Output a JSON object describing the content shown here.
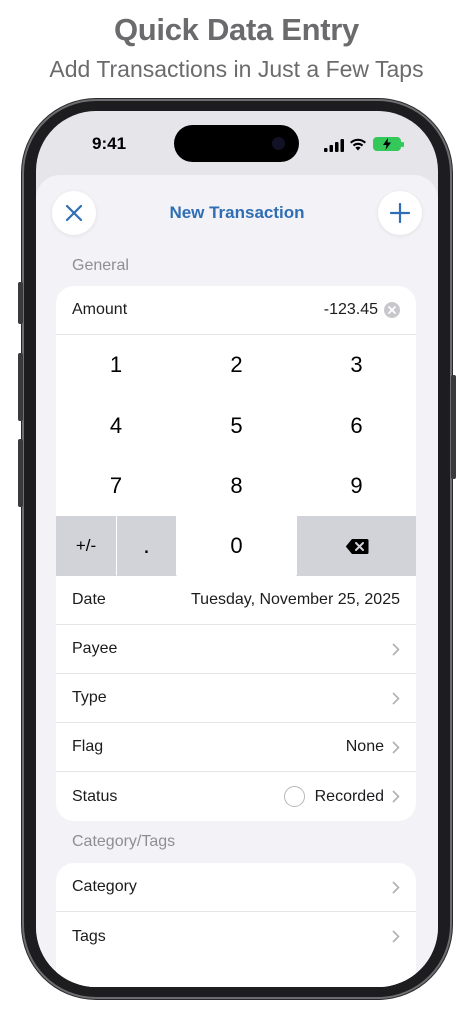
{
  "promo": {
    "title": "Quick Data Entry",
    "subtitle": "Add Transactions in Just a Few Taps"
  },
  "status_bar": {
    "time": "9:41"
  },
  "nav": {
    "title": "New Transaction",
    "close_icon": "close-icon",
    "add_icon": "plus-icon"
  },
  "general": {
    "section_title": "General",
    "amount_label": "Amount",
    "amount_value": "-123.45",
    "keypad": {
      "k1": "1",
      "k2": "2",
      "k3": "3",
      "k4": "4",
      "k5": "5",
      "k6": "6",
      "k7": "7",
      "k8": "8",
      "k9": "9",
      "sign": "+/-",
      "dot": ".",
      "k0": "0",
      "backspace_icon": "backspace-icon"
    },
    "date_label": "Date",
    "date_value": "Tuesday, November 25, 2025",
    "payee_label": "Payee",
    "type_label": "Type",
    "flag_label": "Flag",
    "flag_value": "None",
    "status_label": "Status",
    "status_value": "Recorded"
  },
  "category_tags": {
    "section_title": "Category/Tags",
    "category_label": "Category",
    "tags_label": "Tags"
  },
  "colors": {
    "accent": "#2f6eb5",
    "sheet_bg": "#f2f2f7",
    "keypad_gray": "#d1d3d9",
    "battery": "#34c759"
  }
}
